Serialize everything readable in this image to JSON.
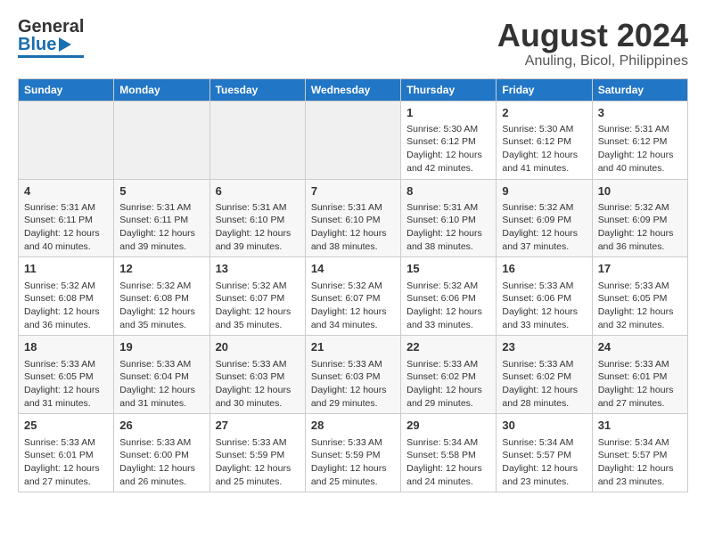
{
  "header": {
    "logo_general": "General",
    "logo_blue": "Blue",
    "title": "August 2024",
    "subtitle": "Anuling, Bicol, Philippines"
  },
  "calendar": {
    "days_of_week": [
      "Sunday",
      "Monday",
      "Tuesday",
      "Wednesday",
      "Thursday",
      "Friday",
      "Saturday"
    ],
    "weeks": [
      [
        {
          "day": "",
          "content": ""
        },
        {
          "day": "",
          "content": ""
        },
        {
          "day": "",
          "content": ""
        },
        {
          "day": "",
          "content": ""
        },
        {
          "day": "1",
          "content": "Sunrise: 5:30 AM\nSunset: 6:12 PM\nDaylight: 12 hours\nand 42 minutes."
        },
        {
          "day": "2",
          "content": "Sunrise: 5:30 AM\nSunset: 6:12 PM\nDaylight: 12 hours\nand 41 minutes."
        },
        {
          "day": "3",
          "content": "Sunrise: 5:31 AM\nSunset: 6:12 PM\nDaylight: 12 hours\nand 40 minutes."
        }
      ],
      [
        {
          "day": "4",
          "content": "Sunrise: 5:31 AM\nSunset: 6:11 PM\nDaylight: 12 hours\nand 40 minutes."
        },
        {
          "day": "5",
          "content": "Sunrise: 5:31 AM\nSunset: 6:11 PM\nDaylight: 12 hours\nand 39 minutes."
        },
        {
          "day": "6",
          "content": "Sunrise: 5:31 AM\nSunset: 6:10 PM\nDaylight: 12 hours\nand 39 minutes."
        },
        {
          "day": "7",
          "content": "Sunrise: 5:31 AM\nSunset: 6:10 PM\nDaylight: 12 hours\nand 38 minutes."
        },
        {
          "day": "8",
          "content": "Sunrise: 5:31 AM\nSunset: 6:10 PM\nDaylight: 12 hours\nand 38 minutes."
        },
        {
          "day": "9",
          "content": "Sunrise: 5:32 AM\nSunset: 6:09 PM\nDaylight: 12 hours\nand 37 minutes."
        },
        {
          "day": "10",
          "content": "Sunrise: 5:32 AM\nSunset: 6:09 PM\nDaylight: 12 hours\nand 36 minutes."
        }
      ],
      [
        {
          "day": "11",
          "content": "Sunrise: 5:32 AM\nSunset: 6:08 PM\nDaylight: 12 hours\nand 36 minutes."
        },
        {
          "day": "12",
          "content": "Sunrise: 5:32 AM\nSunset: 6:08 PM\nDaylight: 12 hours\nand 35 minutes."
        },
        {
          "day": "13",
          "content": "Sunrise: 5:32 AM\nSunset: 6:07 PM\nDaylight: 12 hours\nand 35 minutes."
        },
        {
          "day": "14",
          "content": "Sunrise: 5:32 AM\nSunset: 6:07 PM\nDaylight: 12 hours\nand 34 minutes."
        },
        {
          "day": "15",
          "content": "Sunrise: 5:32 AM\nSunset: 6:06 PM\nDaylight: 12 hours\nand 33 minutes."
        },
        {
          "day": "16",
          "content": "Sunrise: 5:33 AM\nSunset: 6:06 PM\nDaylight: 12 hours\nand 33 minutes."
        },
        {
          "day": "17",
          "content": "Sunrise: 5:33 AM\nSunset: 6:05 PM\nDaylight: 12 hours\nand 32 minutes."
        }
      ],
      [
        {
          "day": "18",
          "content": "Sunrise: 5:33 AM\nSunset: 6:05 PM\nDaylight: 12 hours\nand 31 minutes."
        },
        {
          "day": "19",
          "content": "Sunrise: 5:33 AM\nSunset: 6:04 PM\nDaylight: 12 hours\nand 31 minutes."
        },
        {
          "day": "20",
          "content": "Sunrise: 5:33 AM\nSunset: 6:03 PM\nDaylight: 12 hours\nand 30 minutes."
        },
        {
          "day": "21",
          "content": "Sunrise: 5:33 AM\nSunset: 6:03 PM\nDaylight: 12 hours\nand 29 minutes."
        },
        {
          "day": "22",
          "content": "Sunrise: 5:33 AM\nSunset: 6:02 PM\nDaylight: 12 hours\nand 29 minutes."
        },
        {
          "day": "23",
          "content": "Sunrise: 5:33 AM\nSunset: 6:02 PM\nDaylight: 12 hours\nand 28 minutes."
        },
        {
          "day": "24",
          "content": "Sunrise: 5:33 AM\nSunset: 6:01 PM\nDaylight: 12 hours\nand 27 minutes."
        }
      ],
      [
        {
          "day": "25",
          "content": "Sunrise: 5:33 AM\nSunset: 6:01 PM\nDaylight: 12 hours\nand 27 minutes."
        },
        {
          "day": "26",
          "content": "Sunrise: 5:33 AM\nSunset: 6:00 PM\nDaylight: 12 hours\nand 26 minutes."
        },
        {
          "day": "27",
          "content": "Sunrise: 5:33 AM\nSunset: 5:59 PM\nDaylight: 12 hours\nand 25 minutes."
        },
        {
          "day": "28",
          "content": "Sunrise: 5:33 AM\nSunset: 5:59 PM\nDaylight: 12 hours\nand 25 minutes."
        },
        {
          "day": "29",
          "content": "Sunrise: 5:34 AM\nSunset: 5:58 PM\nDaylight: 12 hours\nand 24 minutes."
        },
        {
          "day": "30",
          "content": "Sunrise: 5:34 AM\nSunset: 5:57 PM\nDaylight: 12 hours\nand 23 minutes."
        },
        {
          "day": "31",
          "content": "Sunrise: 5:34 AM\nSunset: 5:57 PM\nDaylight: 12 hours\nand 23 minutes."
        }
      ]
    ]
  }
}
